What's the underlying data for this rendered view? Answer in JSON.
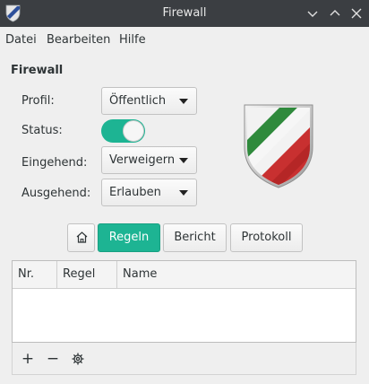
{
  "window": {
    "title": "Firewall",
    "icon": "shield-app-icon",
    "controls": [
      "chevron-down-icon",
      "chevron-up-icon",
      "close-icon"
    ]
  },
  "menu": {
    "items": [
      "Datei",
      "Bearbeiten",
      "Hilfe"
    ]
  },
  "section": {
    "title": "Firewall"
  },
  "form": {
    "profile_label": "Profil:",
    "profile_value": "Öffentlich",
    "status_label": "Status:",
    "status_on": true,
    "incoming_label": "Eingehend:",
    "incoming_value": "Verweigern",
    "outgoing_label": "Ausgehend:",
    "outgoing_value": "Erlauben"
  },
  "tabs": {
    "home_icon": "home-icon",
    "items": [
      "Regeln",
      "Bericht",
      "Protokoll"
    ],
    "active": "Regeln"
  },
  "table": {
    "columns": [
      "Nr.",
      "Regel",
      "Name"
    ],
    "rows": []
  },
  "toolbar": {
    "add": "+",
    "remove": "−",
    "settings_icon": "gear-icon"
  },
  "colors": {
    "accent": "#1db493",
    "titlebar": "#3b3e42"
  }
}
